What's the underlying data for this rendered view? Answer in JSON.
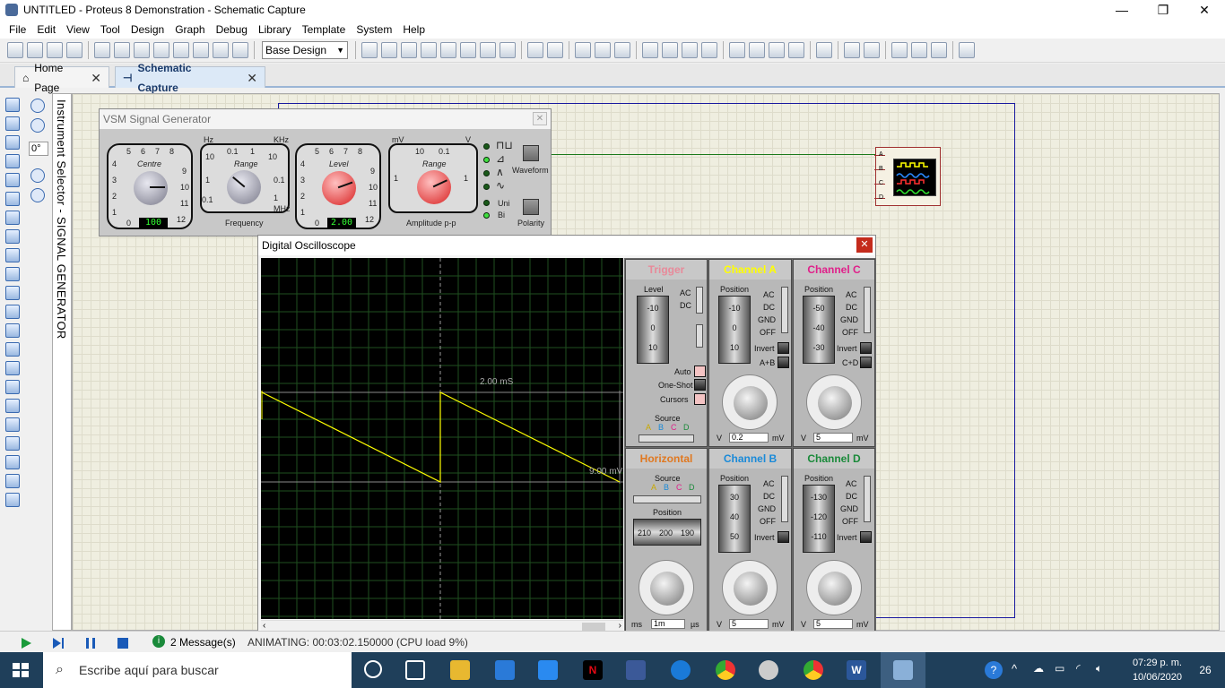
{
  "window": {
    "title": "UNTITLED - Proteus 8 Demonstration - Schematic Capture"
  },
  "menu": [
    "File",
    "Edit",
    "View",
    "Tool",
    "Design",
    "Graph",
    "Debug",
    "Library",
    "Template",
    "System",
    "Help"
  ],
  "toolbar": {
    "design_combo": "Base Design"
  },
  "tabs": [
    {
      "label": "Home Page"
    },
    {
      "label": "Schematic Capture"
    }
  ],
  "left_panel": {
    "angle": "0°",
    "instrument_selector": "Instrument Selector - SIGNAL GENERATOR"
  },
  "oscilloscope_component": {
    "pins": [
      "A",
      "B",
      "C",
      "D"
    ]
  },
  "signal_generator": {
    "title": "VSM Signal Generator",
    "centre": {
      "label": "Centre",
      "ticks": [
        "5",
        "6",
        "7",
        "8",
        "9",
        "10",
        "11",
        "12",
        "4",
        "3",
        "2",
        "1",
        "0"
      ],
      "display": "100"
    },
    "freq_range": {
      "label": "Range",
      "units_top": "Hz",
      "units_top2": "KHz",
      "units_bottom": "MHz",
      "ticks": [
        "0.1",
        "1",
        "10",
        "1",
        "0.1",
        "10",
        "0.1"
      ],
      "caption": "Frequency"
    },
    "level": {
      "label": "Level",
      "ticks": [
        "5",
        "6",
        "7",
        "8",
        "9",
        "10",
        "11",
        "12",
        "4",
        "3",
        "2",
        "1",
        "0"
      ],
      "display": "2.00"
    },
    "amp_range": {
      "label": "Range",
      "unit_left": "mV",
      "unit_right": "V",
      "ticks": [
        "10",
        "0.1",
        "1",
        "1"
      ],
      "caption": "Amplitude p-p"
    },
    "waveform_label": "Waveform",
    "polarity": {
      "uni": "Uni",
      "bi": "Bi",
      "label": "Polarity"
    }
  },
  "scope": {
    "title": "Digital Oscilloscope",
    "cursor_time": "2.00 mS",
    "cursor_volt": "9.00 mV",
    "trace_color": "#ffff00",
    "trigger": {
      "title": "Trigger",
      "level": "Level",
      "ticks": [
        "-10",
        "0",
        "10"
      ],
      "ac": "AC",
      "dc": "DC",
      "auto": "Auto",
      "oneshot": "One-Shot",
      "cursors": "Cursors",
      "source": "Source",
      "sources": [
        "A",
        "B",
        "C",
        "D"
      ]
    },
    "channel_a": {
      "title": "Channel A",
      "color": "#ffff00",
      "position": "Position",
      "ticks": [
        "-10",
        "0",
        "10"
      ],
      "ac": "AC",
      "dc": "DC",
      "gnd": "GND",
      "off": "OFF",
      "invert": "Invert",
      "combine": "A+B",
      "volts_entry": "0.2",
      "unit_v": "V",
      "unit_mv": "mV"
    },
    "channel_c": {
      "title": "Channel C",
      "color": "#e0208a",
      "position": "Position",
      "ticks": [
        "-50",
        "-40",
        "-30"
      ],
      "ac": "AC",
      "dc": "DC",
      "gnd": "GND",
      "off": "OFF",
      "invert": "Invert",
      "combine": "C+D",
      "volts_entry": "5",
      "unit_v": "V",
      "unit_mv": "mV"
    },
    "horizontal": {
      "title": "Horizontal",
      "source": "Source",
      "sources": [
        "A",
        "B",
        "C",
        "D"
      ],
      "position": "Position",
      "scale": [
        "210",
        "200",
        "190"
      ],
      "time_entry": "1m",
      "unit_ms": "ms",
      "unit_us": "µs"
    },
    "channel_b": {
      "title": "Channel B",
      "color": "#1a8ad8",
      "position": "Position",
      "ticks": [
        "30",
        "40",
        "50"
      ],
      "ac": "AC",
      "dc": "DC",
      "gnd": "GND",
      "off": "OFF",
      "invert": "Invert",
      "volts_entry": "5",
      "unit_v": "V",
      "unit_mv": "mV"
    },
    "channel_d": {
      "title": "Channel D",
      "color": "#1a8a3a",
      "position": "Position",
      "ticks": [
        "-130",
        "-120",
        "-110"
      ],
      "ac": "AC",
      "dc": "DC",
      "gnd": "GND",
      "off": "OFF",
      "invert": "Invert",
      "volts_entry": "5",
      "unit_v": "V",
      "unit_mv": "mV"
    }
  },
  "status": {
    "messages": "2 Message(s)",
    "animating": "ANIMATING: 00:03:02.150000 (CPU load 9%)"
  },
  "taskbar": {
    "search": "Escribe aquí para buscar",
    "time": "07:29 p. m.",
    "date": "10/06/2020",
    "notifications": "26"
  }
}
